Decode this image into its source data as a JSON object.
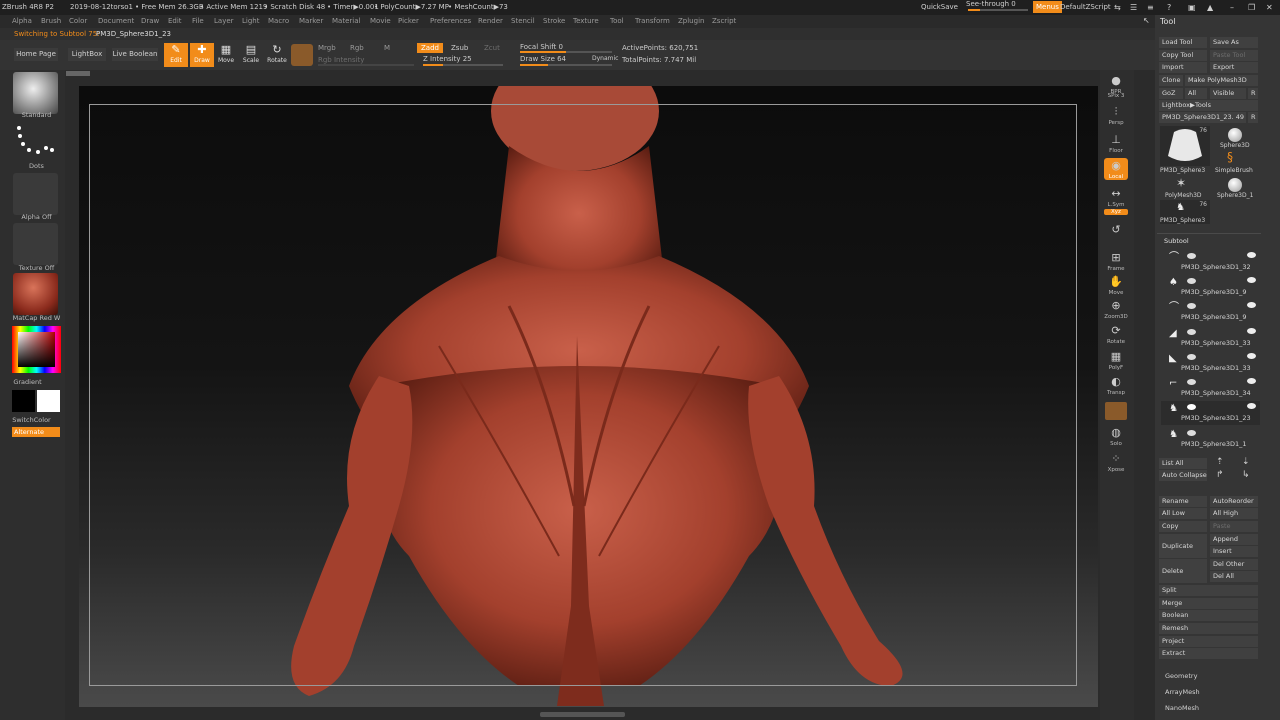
{
  "titlebar": {
    "app": "ZBrush 4R8 P2",
    "doc": "2019-08-12torso1",
    "free_mem": "• Free Mem 26.3GB",
    "active_mem": "• Active Mem 1219",
    "scratch": "• Scratch Disk 48",
    "timer": "• Timer▶0.001",
    "polycount": "• PolyCount▶7.27 MP",
    "meshcount": "• MeshCount▶73",
    "quicksave": "QuickSave",
    "see_through": "See-through  0",
    "menus": "Menus",
    "zscript": "DefaultZScript"
  },
  "menus": [
    "Alpha",
    "Brush",
    "Color",
    "Document",
    "Draw",
    "Edit",
    "File",
    "Layer",
    "Light",
    "Macro",
    "Marker",
    "Material",
    "Movie",
    "Picker",
    "Preferences",
    "Render",
    "Stencil",
    "Stroke",
    "Texture",
    "Tool",
    "Transform",
    "Zplugin",
    "Zscript"
  ],
  "status": {
    "message": "Switching to Subtool 75:",
    "subtool": "PM3D_Sphere3D1_23"
  },
  "toolbar": {
    "home": "Home Page",
    "lightbox": "LightBox",
    "live_boolean": "Live Boolean",
    "edit": "Edit",
    "draw": "Draw",
    "move": "Move",
    "scale": "Scale",
    "rotate": "Rotate",
    "mrgb": "Mrgb",
    "rgb": "Rgb",
    "m": "M",
    "rgb_intensity": "Rgb Intensity",
    "zadd": "Zadd",
    "zsub": "Zsub",
    "zcut": "Zcut",
    "z_intensity": "Z Intensity 25",
    "focal_shift": "Focal Shift 0",
    "draw_size": "Draw Size 64",
    "dynamic": "Dynamic",
    "active_points": "ActivePoints: 620,751",
    "total_points": "TotalPoints: 7.747 Mil"
  },
  "left": {
    "brush": "Standard",
    "stroke": "Dots",
    "alpha": "Alpha Off",
    "texture": "Texture Off",
    "material": "MatCap Red W",
    "gradient": "Gradient",
    "switch": "SwitchColor",
    "alternate": "Alternate"
  },
  "rightshelf": [
    "BPR",
    "SPix 3",
    "Persp",
    "Floor",
    "Local",
    "L.Sym",
    "Xyz",
    "",
    "",
    "Frame",
    "Move",
    "Zoom3D",
    "Rotate",
    "PolyF",
    "Transp",
    "",
    "Solo",
    "Xpose"
  ],
  "tool": {
    "title": "Tool",
    "load": "Load Tool",
    "save_as": "Save As",
    "copy": "Copy Tool",
    "paste": "Paste Tool",
    "import": "Import",
    "export": "Export",
    "clone": "Clone",
    "make_poly": "Make PolyMesh3D",
    "goz": "GoZ",
    "all": "All",
    "visible": "Visible",
    "r": "R",
    "lightbox_tools": "Lightbox▶Tools",
    "current": "PM3D_Sphere3D1_23. 49",
    "r2": "R",
    "thumbs": [
      {
        "label": "PM3D_Sphere3",
        "count": "76"
      },
      {
        "label": "Sphere3D"
      },
      {
        "label": "SimpleBrush"
      },
      {
        "label": "PolyMesh3D"
      },
      {
        "label": "Sphere3D_1"
      },
      {
        "label": "PM3D_Sphere3",
        "count": "76"
      }
    ],
    "subtool_title": "Subtool",
    "subtools": [
      "PM3D_Sphere3D1_32",
      "PM3D_Sphere3D1_9",
      "PM3D_Sphere3D1_9",
      "PM3D_Sphere3D1_33",
      "PM3D_Sphere3D1_33",
      "PM3D_Sphere3D1_34",
      "PM3D_Sphere3D1_23",
      "PM3D_Sphere3D1_1"
    ],
    "list_all": "List All",
    "auto_collapse": "Auto Collapse",
    "rename": "Rename",
    "auto_reorder": "AutoReorder",
    "all_low": "All Low",
    "all_high": "All High",
    "copy2": "Copy",
    "paste2": "Paste",
    "duplicate": "Duplicate",
    "append": "Append",
    "insert": "Insert",
    "delete": "Delete",
    "del_other": "Del Other",
    "del_all": "Del All",
    "split": "Split",
    "merge": "Merge",
    "boolean": "Boolean",
    "remesh": "Remesh",
    "project": "Project",
    "extract": "Extract",
    "geometry": "Geometry",
    "arraymesh": "ArrayMesh",
    "nanomesh": "NanoMesh"
  },
  "colors": {
    "accent": "#f28c1a",
    "skin": "#b14a36"
  }
}
